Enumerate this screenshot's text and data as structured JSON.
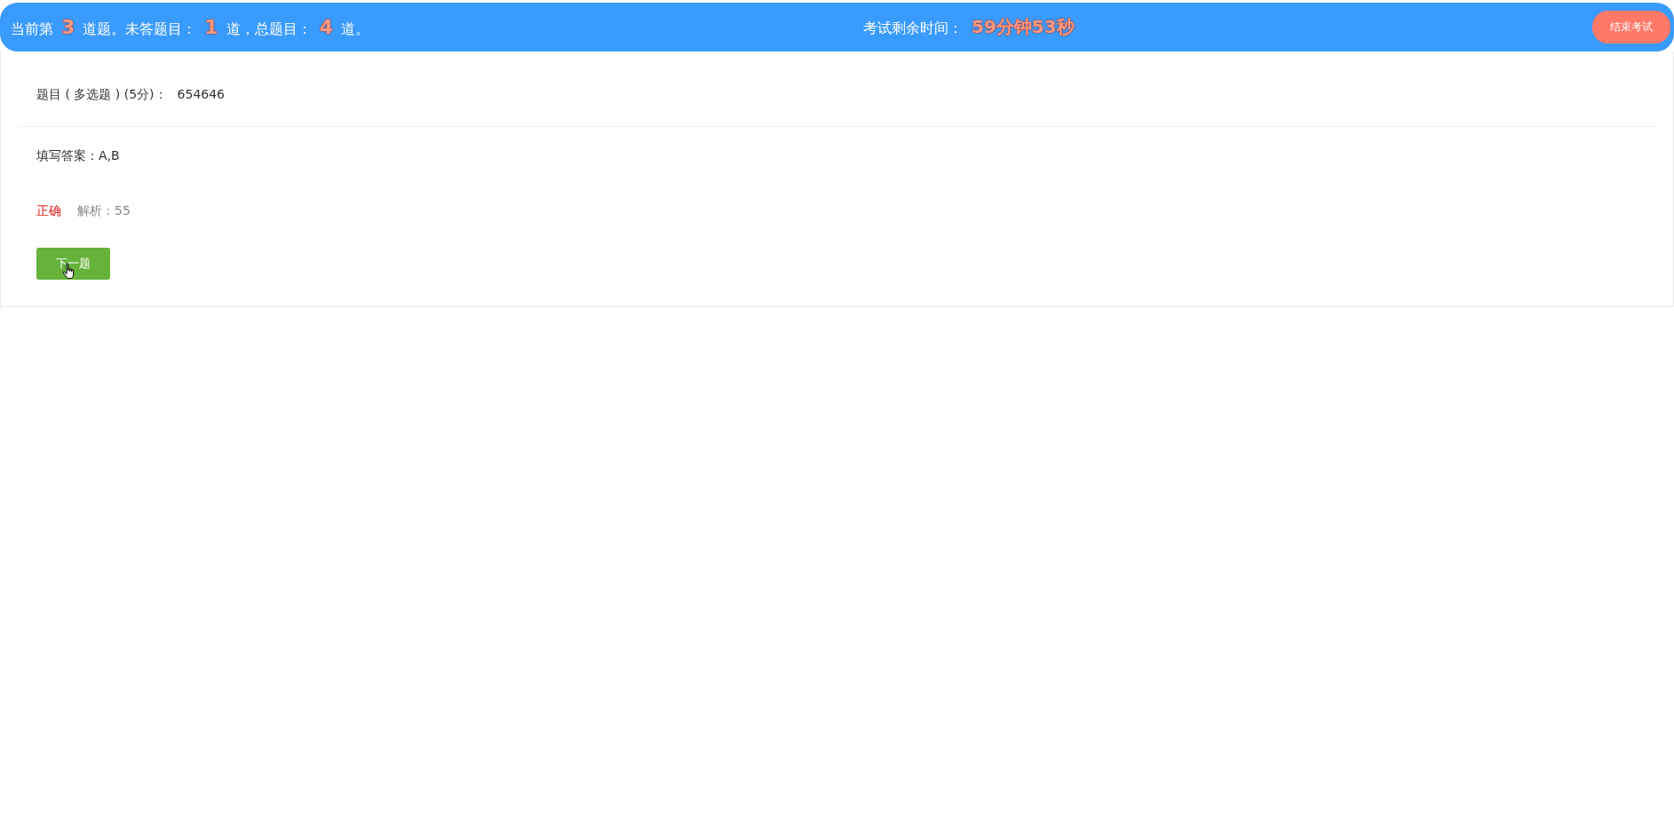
{
  "header": {
    "progress": [
      {
        "kind": "text",
        "text": "当前第"
      },
      {
        "kind": "number",
        "text": "3"
      },
      {
        "kind": "text",
        "text": "道题。未答题目："
      },
      {
        "kind": "number",
        "text": "1"
      },
      {
        "kind": "text",
        "text": "道，总题目："
      },
      {
        "kind": "number",
        "text": "4"
      },
      {
        "kind": "text",
        "text": "道。"
      }
    ],
    "timer_label": "考试剩余时间：",
    "timer_value": "59分钟53秒",
    "end_button": "结束考试"
  },
  "question": {
    "title": "题目 ( 多选题 ) (5分)：",
    "content": "654646"
  },
  "answer": {
    "label": "填写答案：",
    "value": "A,B"
  },
  "result": {
    "verdict": "正确",
    "correct": true,
    "explanation": "解析：55"
  },
  "next_button": "下一题"
}
